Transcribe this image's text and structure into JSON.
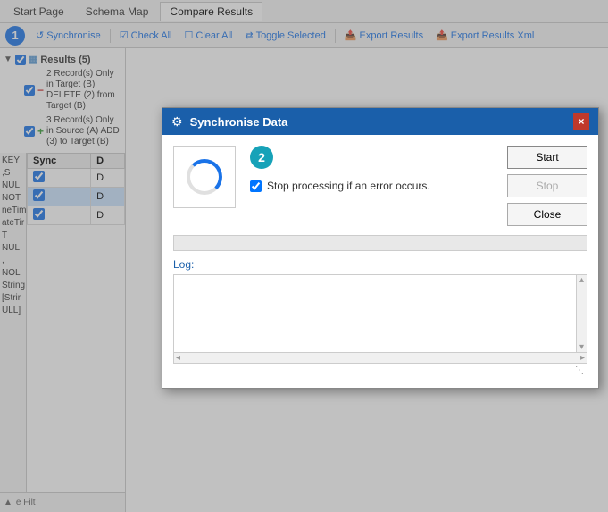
{
  "tabs": {
    "items": [
      {
        "label": "Start Page",
        "active": false
      },
      {
        "label": "Schema Map",
        "active": false
      },
      {
        "label": "Compare Results",
        "active": true
      }
    ]
  },
  "toolbar": {
    "buttons": [
      {
        "label": "Synchronise",
        "icon": "↺",
        "key": "synchronise-btn"
      },
      {
        "label": "Check All",
        "icon": "☑",
        "key": "check-all-btn"
      },
      {
        "label": "Clear All",
        "icon": "☐",
        "key": "clear-all-btn"
      },
      {
        "label": "Toggle Selected",
        "icon": "⇄",
        "key": "toggle-selected-btn"
      },
      {
        "label": "Export Results",
        "icon": "📤",
        "key": "export-results-btn"
      },
      {
        "label": "Export Results Xml",
        "icon": "📤",
        "key": "export-xml-btn"
      }
    ]
  },
  "results_tree": {
    "header": "Results (5)",
    "items": [
      {
        "icon": "−",
        "icon_type": "minus",
        "text": "2 Record(s) Only in Target (B) DELETE (2) from Target (B)"
      },
      {
        "icon": "+",
        "icon_type": "plus",
        "text": "3 Record(s) Only in Source (A) ADD (3) to Target (B)"
      }
    ]
  },
  "data_table": {
    "columns": [
      "Sync"
    ],
    "rows": [
      {
        "sync": true,
        "selected": false
      },
      {
        "sync": true,
        "selected": true
      },
      {
        "sync": true,
        "selected": false
      }
    ],
    "left_labels": [
      "KEY ,S",
      "NUL",
      "NOT",
      "neTim",
      "ateTir",
      "T NUL",
      "NOL",
      "String",
      "[Strir",
      "ULL]"
    ]
  },
  "modal": {
    "title": "Synchronise Data",
    "title_icon": "⚙",
    "close_label": "×",
    "step2_label": "2",
    "start_label": "Start",
    "stop_label": "Stop",
    "close_btn_label": "Close",
    "checkbox_label": "Stop processing if an error occurs.",
    "checkbox_checked": true,
    "progress_value": 0,
    "log_label": "Log:",
    "log_content": ""
  },
  "step_badge": {
    "label": "1"
  },
  "filter_label": "e Filt"
}
